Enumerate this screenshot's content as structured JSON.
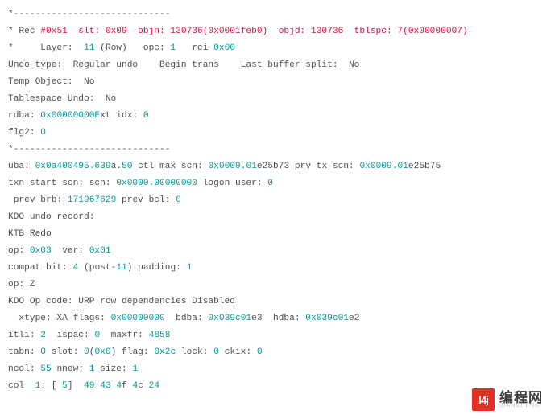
{
  "lines": [
    [
      [
        "",
        "*-----------------------------"
      ]
    ],
    [
      [
        "",
        "* Rec "
      ],
      [
        "red",
        "#0x51  slt: 0x09  objn: 130736(0x0001feb0)  objd: 130736  tblspc: 7(0x00000007)"
      ]
    ],
    [
      [
        "",
        "*     Layer:  "
      ],
      [
        "teal",
        "11"
      ],
      [
        "",
        " (Row)   opc: "
      ],
      [
        "teal",
        "1"
      ],
      [
        "",
        "   rci "
      ],
      [
        "teal",
        "0x00"
      ]
    ],
    [
      [
        "",
        "Undo type:  Regular undo    Begin trans    Last buffer split:  No "
      ]
    ],
    [
      [
        "",
        "Temp Object:  No "
      ]
    ],
    [
      [
        "",
        "Tablespace Undo:  No "
      ]
    ],
    [
      [
        "",
        "rdba: "
      ],
      [
        "teal",
        "0x00000000E"
      ],
      [
        "",
        "xt idx: "
      ],
      [
        "teal",
        "0"
      ]
    ],
    [
      [
        "",
        "flg2: "
      ],
      [
        "teal",
        "0"
      ]
    ],
    [
      [
        "",
        "*-----------------------------"
      ]
    ],
    [
      [
        "",
        "uba: "
      ],
      [
        "teal",
        "0x0a400495.639"
      ],
      [
        "",
        "a."
      ],
      [
        "teal",
        "50"
      ],
      [
        "",
        " ctl max scn: "
      ],
      [
        "teal",
        "0x0009.01"
      ],
      [
        "",
        "e25b73 prv tx scn: "
      ],
      [
        "teal",
        "0x0009.01"
      ],
      [
        "",
        "e25b75"
      ]
    ],
    [
      [
        "",
        "txn start scn: scn: "
      ],
      [
        "teal",
        "0x0000.00000000"
      ],
      [
        "",
        " logon user: "
      ],
      [
        "teal",
        "0"
      ]
    ],
    [
      [
        "",
        " prev brb: "
      ],
      [
        "teal",
        "171967629"
      ],
      [
        "",
        " prev bcl: "
      ],
      [
        "teal",
        "0"
      ]
    ],
    [
      [
        "",
        "KDO undo record:"
      ]
    ],
    [
      [
        "",
        "KTB Redo "
      ]
    ],
    [
      [
        "",
        "op: "
      ],
      [
        "teal",
        "0x03"
      ],
      [
        "",
        "  ver: "
      ],
      [
        "teal",
        "0x01"
      ],
      [
        "",
        "  "
      ]
    ],
    [
      [
        "",
        "compat bit: "
      ],
      [
        "teal",
        "4"
      ],
      [
        "",
        " (post-"
      ],
      [
        "teal",
        "11"
      ],
      [
        "",
        ") padding: "
      ],
      [
        "teal",
        "1"
      ]
    ],
    [
      [
        "",
        "op: Z"
      ]
    ],
    [
      [
        "",
        "KDO Op code: URP row dependencies Disabled"
      ]
    ],
    [
      [
        "",
        "  xtype: XA flags: "
      ],
      [
        "teal",
        "0x00000000"
      ],
      [
        "",
        "  bdba: "
      ],
      [
        "teal",
        "0x039c01"
      ],
      [
        "",
        "e3  hdba: "
      ],
      [
        "teal",
        "0x039c01"
      ],
      [
        "",
        "e2"
      ]
    ],
    [
      [
        "",
        "itli: "
      ],
      [
        "teal",
        "2"
      ],
      [
        "",
        "  ispac: "
      ],
      [
        "teal",
        "0"
      ],
      [
        "",
        "  maxfr: "
      ],
      [
        "teal",
        "4858"
      ]
    ],
    [
      [
        "",
        "tabn: "
      ],
      [
        "teal",
        "0"
      ],
      [
        "",
        " slot: "
      ],
      [
        "teal",
        "0"
      ],
      [
        "",
        "("
      ],
      [
        "teal",
        "0x0"
      ],
      [
        "",
        ") flag: "
      ],
      [
        "teal",
        "0x2c"
      ],
      [
        "",
        " lock: "
      ],
      [
        "teal",
        "0"
      ],
      [
        "",
        " ckix: "
      ],
      [
        "teal",
        "0"
      ]
    ],
    [
      [
        "",
        "ncol: "
      ],
      [
        "teal",
        "55"
      ],
      [
        "",
        " nnew: "
      ],
      [
        "teal",
        "1"
      ],
      [
        "",
        " size: "
      ],
      [
        "teal",
        "1"
      ]
    ],
    [
      [
        "",
        "col  "
      ],
      [
        "teal",
        "1"
      ],
      [
        "",
        ": [ "
      ],
      [
        "teal",
        "5"
      ],
      [
        "",
        "]  "
      ],
      [
        "teal",
        "49"
      ],
      [
        "",
        " "
      ],
      [
        "teal",
        "43 4"
      ],
      [
        "",
        "f "
      ],
      [
        "teal",
        "4"
      ],
      [
        "",
        "c "
      ],
      [
        "teal",
        "24"
      ]
    ]
  ],
  "watermark": {
    "badge": "l4j",
    "text": "编程网",
    "sub": "BIANCHENG"
  }
}
